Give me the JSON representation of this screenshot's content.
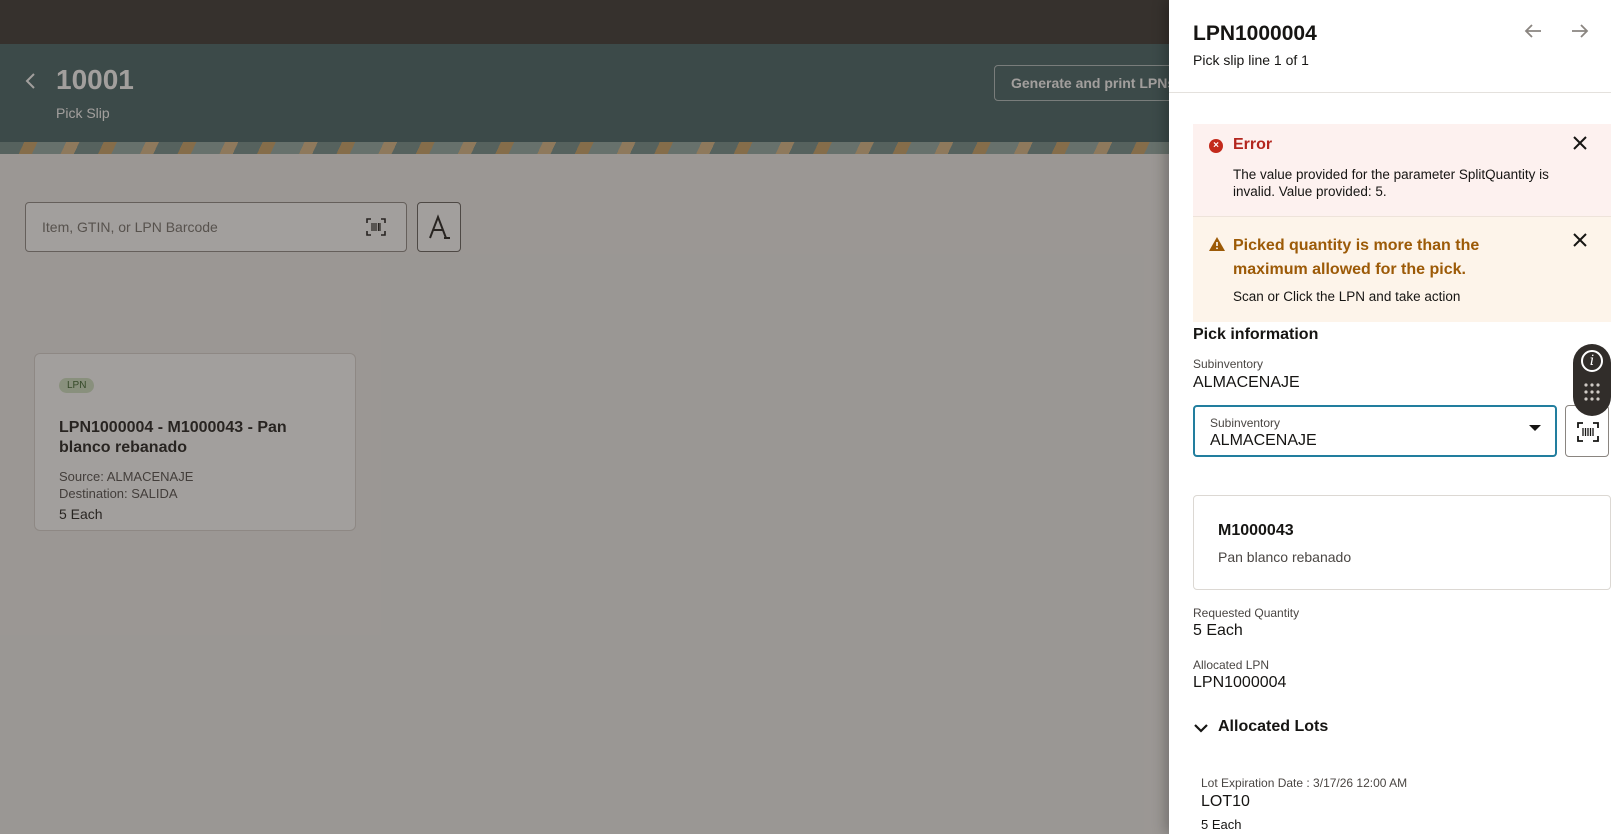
{
  "header": {
    "title": "10001",
    "subtitle": "Pick Slip",
    "generate_button": "Generate and print LPNs"
  },
  "search": {
    "placeholder": "Item, GTIN, or LPN Barcode"
  },
  "lpn_card": {
    "badge": "LPN",
    "title": "LPN1000004 - M1000043 - Pan blanco rebanado",
    "source": "Source: ALMACENAJE",
    "destination": "Destination: SALIDA",
    "quantity": "5 Each"
  },
  "drawer": {
    "title": "LPN1000004",
    "subtitle": "Pick slip line 1 of 1",
    "error": {
      "title": "Error",
      "body": "The value provided for the parameter SplitQuantity is invalid. Value provided: 5."
    },
    "warning": {
      "title": "Picked quantity is more than the maximum allowed for the pick.",
      "body": "Scan or Click the LPN and take action"
    },
    "pick_info": {
      "heading": "Pick information",
      "subinventory_label": "Subinventory",
      "subinventory_value": "ALMACENAJE",
      "select_label": "Subinventory",
      "select_value": "ALMACENAJE"
    },
    "item": {
      "code": "M1000043",
      "description": "Pan blanco rebanado"
    },
    "requested_quantity_label": "Requested Quantity",
    "requested_quantity_value": "5 Each",
    "allocated_lpn_label": "Allocated LPN",
    "allocated_lpn_value": "LPN1000004",
    "allocated_lots_label": "Allocated Lots",
    "lot": {
      "expiration": "Lot Expiration Date : 3/17/26 12:00 AM",
      "name": "LOT10",
      "quantity": "5 Each"
    }
  },
  "colors": {
    "header_bg": "#3d5c5e",
    "topbar_bg": "#312d2a",
    "error_red": "#b3261e",
    "warning_amber": "#9c5a07",
    "focus_border": "#227e9e"
  }
}
